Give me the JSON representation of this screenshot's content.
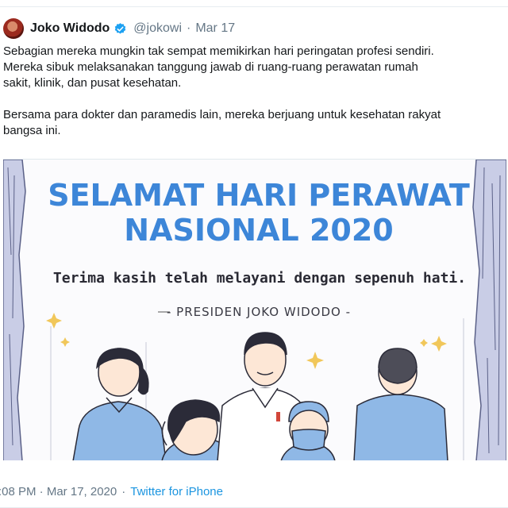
{
  "tweet": {
    "author_name": "Joko Widodo",
    "handle": "@jokowi",
    "separator": "·",
    "date": "Mar 17",
    "text_lines": [
      "Sebagian mereka mungkin tak sempat memikirkan hari peringatan profesi sendiri.",
      "Mereka sibuk melaksanakan tanggung jawab di ruang-ruang perawatan rumah",
      "sakit, klinik, dan pusat kesehatan.",
      "",
      "Bersama para dokter dan paramedis lain, mereka berjuang untuk kesehatan rakyat",
      "bangsa ini."
    ]
  },
  "poster": {
    "title_line1": "SELAMAT HARI PERAWAT",
    "title_line2": "NASIONAL 2020",
    "tagline": "Terima kasih telah melayani dengan sepenuh hati.",
    "signature": "- PRESIDEN JOKO WIDODO -"
  },
  "footer": {
    "time": ":08 PM · Mar 17, 2020",
    "dot": "·",
    "source": "Twitter for iPhone"
  },
  "colors": {
    "title_blue": "#3d86d8",
    "twitter_blue": "#1da1f2",
    "scrub_blue": "#8fb8e6",
    "sparkle_gold": "#f1c75a"
  }
}
